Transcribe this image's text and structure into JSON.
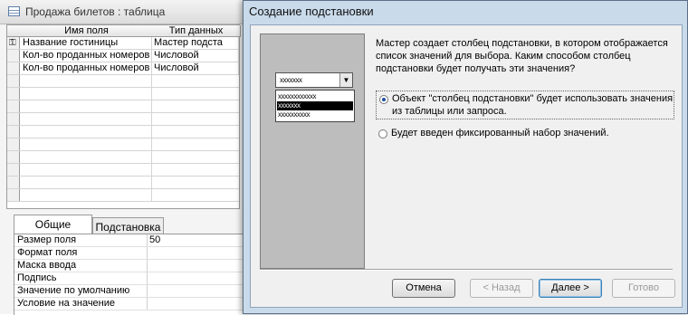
{
  "table_window": {
    "title": "Продажа билетов : таблица",
    "columns": [
      "Имя поля",
      "Тип данных"
    ],
    "rows": [
      {
        "name": "Название гостиницы",
        "type": "Мастер подста"
      },
      {
        "name": "Кол-во проданных номеров",
        "type": "Числовой"
      },
      {
        "name": "Кол-во проданных номеров",
        "type": "Числовой"
      }
    ],
    "property_tabs": [
      "Общие",
      "Подстановка"
    ],
    "properties": [
      {
        "label": "Размер поля",
        "value": "50"
      },
      {
        "label": "Формат поля",
        "value": ""
      },
      {
        "label": "Маска ввода",
        "value": ""
      },
      {
        "label": "Подпись",
        "value": ""
      },
      {
        "label": "Значение по умолчанию",
        "value": ""
      },
      {
        "label": "Условие на значение",
        "value": ""
      }
    ]
  },
  "wizard": {
    "title": "Создание подстановки",
    "description": "Мастер создает столбец подстановки, в котором отображается список значений для выбора.  Каким способом столбец подстановки будет получать эти значения?",
    "sample": {
      "combo_text": "xxxxxxx",
      "list_items": [
        "xxxxxxxxxxxx",
        "xxxxxxx",
        "xxxxxxxxxx"
      ],
      "selected_index": 1
    },
    "options": [
      {
        "label": "Объект \"столбец подстановки\" будет использовать значения из таблицы или запроса.",
        "checked": true
      },
      {
        "label": "Будет введен фиксированный набор значений.",
        "checked": false
      }
    ],
    "buttons": {
      "cancel": "Отмена",
      "back": "< Назад",
      "next": "Далее >",
      "finish": "Готово"
    }
  }
}
